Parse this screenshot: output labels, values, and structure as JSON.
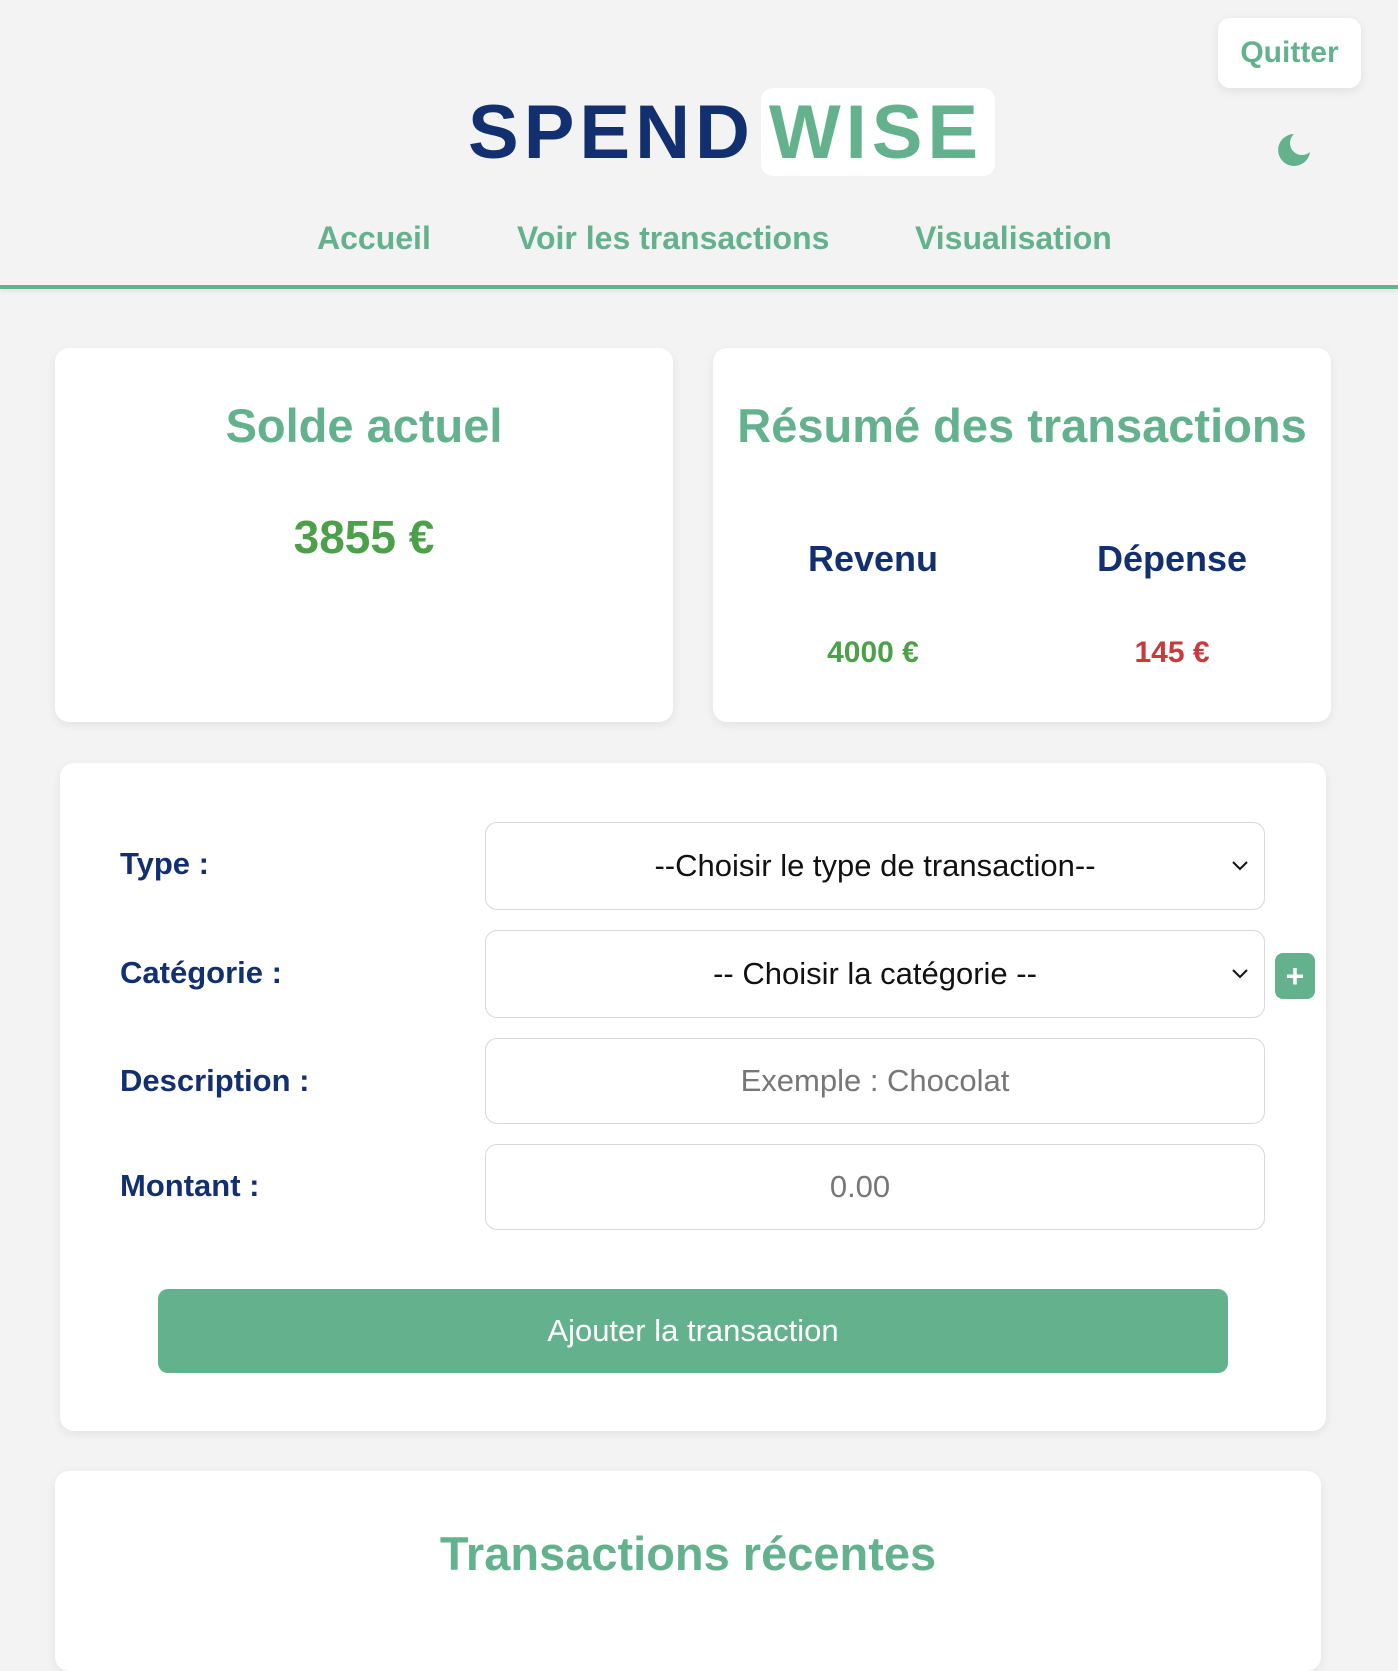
{
  "header": {
    "quit_label": "Quitter",
    "logo_part1": "SPEND",
    "logo_part2": "WISE",
    "theme_toggle_icon": "moon-icon"
  },
  "nav": {
    "items": [
      {
        "label": "Accueil"
      },
      {
        "label": "Voir les transactions"
      },
      {
        "label": "Visualisation"
      }
    ]
  },
  "balance": {
    "title": "Solde actuel",
    "value": "3855 €"
  },
  "summary": {
    "title": "Résumé des transactions",
    "income_label": "Revenu",
    "income_value": "4000 €",
    "expense_label": "Dépense",
    "expense_value": "145 €"
  },
  "form": {
    "type_label": "Type :",
    "type_selected": "--Choisir le type de transaction--",
    "category_label": "Catégorie :",
    "category_selected": "-- Choisir la catégorie --",
    "add_category_icon": "plus-icon",
    "description_label": "Description :",
    "description_placeholder": "Exemple : Chocolat",
    "amount_label": "Montant :",
    "amount_placeholder": "0.00",
    "submit_label": "Ajouter la transaction"
  },
  "recent": {
    "title": "Transactions récentes"
  },
  "colors": {
    "accent": "#63b28d",
    "navy": "#123070",
    "income_green": "#4da04a",
    "expense_red": "#c9393d",
    "background": "#f3f3f3"
  }
}
